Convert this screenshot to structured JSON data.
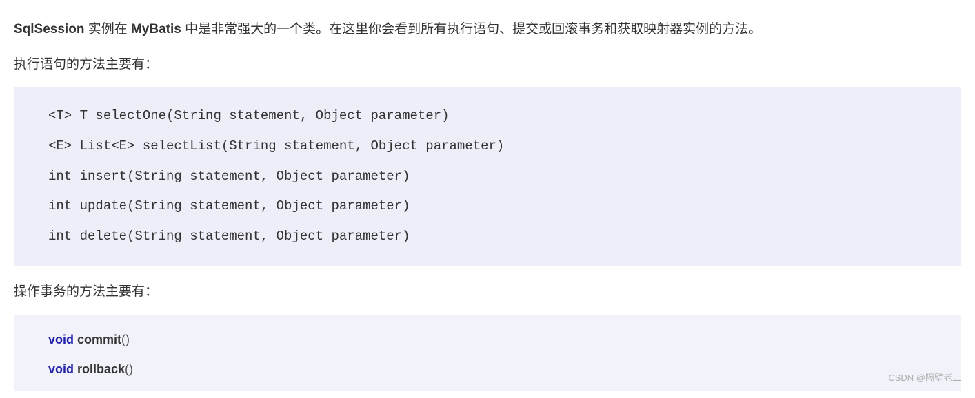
{
  "intro": {
    "part1": "SqlSession",
    "part2": " 实例在 ",
    "part3": "MyBatis",
    "part4": " 中是非常强大的一个类。在这里你会看到所有执行语句、提交或回滚事务和获取映射器实例的方法。"
  },
  "sub1": "执行语句的方法主要有：",
  "code1": {
    "l1": "<T> T selectOne(String statement, Object parameter)",
    "l2": "<E> List<E> selectList(String statement, Object parameter)",
    "l3": "int insert(String statement, Object parameter)",
    "l4": "int update(String statement, Object parameter)",
    "l5": "int delete(String statement, Object parameter)"
  },
  "sub2": "操作事务的方法主要有：",
  "code2": {
    "l1_kw": "void",
    "l1_fn": " commit",
    "l1_p": "()",
    "l2_kw": "void",
    "l2_fn": " rollback",
    "l2_p": "()"
  },
  "watermark": "CSDN @隔壁老二"
}
